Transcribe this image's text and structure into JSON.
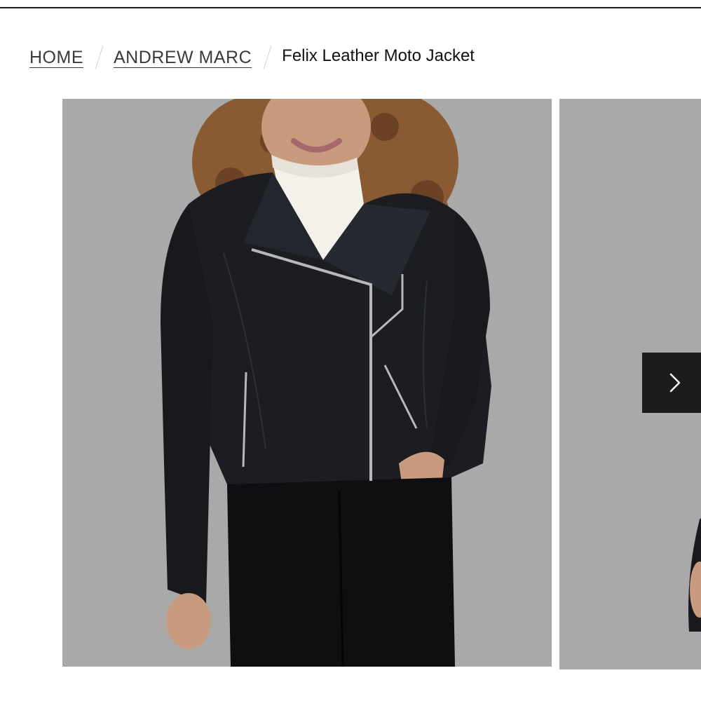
{
  "breadcrumb": {
    "home_label": "HOME",
    "brand_label": "ANDREW MARC",
    "current_label": "Felix Leather Moto Jacket"
  },
  "gallery": {
    "images": [
      {
        "subject": "model wearing black leather moto jacket over white turtleneck and black pants, front view"
      },
      {
        "subject": "second product image, partially visible"
      }
    ],
    "next_icon": "chevron-right-icon"
  },
  "colors": {
    "image_background": "#a9a9a9",
    "nav_button": "#1c1c1c",
    "jacket": "#1b1d22"
  }
}
